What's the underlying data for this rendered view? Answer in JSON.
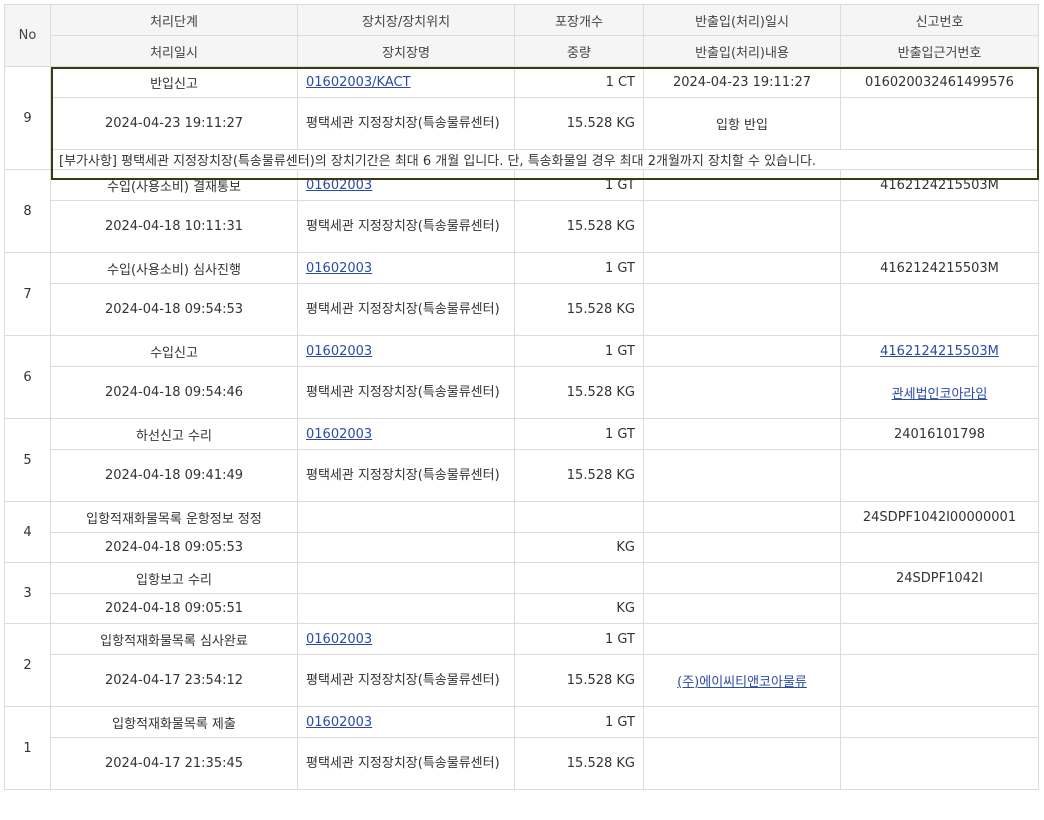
{
  "headers": {
    "no": "No",
    "top": [
      "처리단계",
      "장치장/장치위치",
      "포장개수",
      "반출입(처리)일시",
      "신고번호"
    ],
    "bottom": [
      "처리일시",
      "장치장명",
      "중량",
      "반출입(처리)내용",
      "반출입근거번호"
    ]
  },
  "rows": [
    {
      "no": "9",
      "step": "반입신고",
      "loc_code": "01602003/KACT",
      "loc_link": true,
      "pkg": "1 CT",
      "io_time": "2024-04-23 19:11:27",
      "decl_no": "016020032461499576",
      "decl_link": false,
      "proc_time": "2024-04-23 19:11:27",
      "loc_name": "평택세관 지정장치장(특송물류센터)",
      "weight": "15.528 KG",
      "io_content": "입항 반입",
      "io_link": false,
      "basis_no": "",
      "basis_link": false,
      "note": "[부가사항] 평택세관 지정장치장(특송물류센터)의 장치기간은 최대 6 개월 입니다. 단, 특송화물일 경우 최대 2개월까지 장치할 수 있습니다."
    },
    {
      "no": "8",
      "step": "수입(사용소비) 결재통보",
      "loc_code": "01602003",
      "loc_link": true,
      "pkg": "1 GT",
      "io_time": "",
      "decl_no": "4162124215503M",
      "decl_link": false,
      "proc_time": "2024-04-18 10:11:31",
      "loc_name": "평택세관 지정장치장(특송물류센터)",
      "weight": "15.528 KG",
      "io_content": "",
      "io_link": false,
      "basis_no": "",
      "basis_link": false
    },
    {
      "no": "7",
      "step": "수입(사용소비) 심사진행",
      "loc_code": "01602003",
      "loc_link": true,
      "pkg": "1 GT",
      "io_time": "",
      "decl_no": "4162124215503M",
      "decl_link": false,
      "proc_time": "2024-04-18 09:54:53",
      "loc_name": "평택세관 지정장치장(특송물류센터)",
      "weight": "15.528 KG",
      "io_content": "",
      "io_link": false,
      "basis_no": "",
      "basis_link": false
    },
    {
      "no": "6",
      "step": "수입신고",
      "loc_code": "01602003",
      "loc_link": true,
      "pkg": "1 GT",
      "io_time": "",
      "decl_no": "4162124215503M",
      "decl_link": true,
      "proc_time": "2024-04-18 09:54:46",
      "loc_name": "평택세관 지정장치장(특송물류센터)",
      "weight": "15.528 KG",
      "io_content": "",
      "io_link": false,
      "basis_no": "관세법인코아라임",
      "basis_link": true
    },
    {
      "no": "5",
      "step": "하선신고 수리",
      "loc_code": "01602003",
      "loc_link": true,
      "pkg": "1 GT",
      "io_time": "",
      "decl_no": "24016101798",
      "decl_link": false,
      "proc_time": "2024-04-18 09:41:49",
      "loc_name": "평택세관 지정장치장(특송물류센터)",
      "weight": "15.528 KG",
      "io_content": "",
      "io_link": false,
      "basis_no": "",
      "basis_link": false
    },
    {
      "no": "4",
      "step": "입항적재화물목록 운항정보 정정",
      "loc_code": "",
      "loc_link": false,
      "pkg": "",
      "io_time": "",
      "decl_no": "24SDPF1042I00000001",
      "decl_link": false,
      "proc_time": "2024-04-18 09:05:53",
      "loc_name": "",
      "weight": "KG",
      "io_content": "",
      "io_link": false,
      "basis_no": "",
      "basis_link": false
    },
    {
      "no": "3",
      "step": "입항보고 수리",
      "loc_code": "",
      "loc_link": false,
      "pkg": "",
      "io_time": "",
      "decl_no": "24SDPF1042I",
      "decl_link": false,
      "proc_time": "2024-04-18 09:05:51",
      "loc_name": "",
      "weight": "KG",
      "io_content": "",
      "io_link": false,
      "basis_no": "",
      "basis_link": false
    },
    {
      "no": "2",
      "step": "입항적재화물목록 심사완료",
      "loc_code": "01602003",
      "loc_link": true,
      "pkg": "1 GT",
      "io_time": "",
      "decl_no": "",
      "decl_link": false,
      "proc_time": "2024-04-17 23:54:12",
      "loc_name": "평택세관 지정장치장(특송물류센터)",
      "weight": "15.528 KG",
      "io_content": "(주)에이씨티앤코아물류",
      "io_link": true,
      "basis_no": "",
      "basis_link": false
    },
    {
      "no": "1",
      "step": "입항적재화물목록 제출",
      "loc_code": "01602003",
      "loc_link": true,
      "pkg": "1 GT",
      "io_time": "",
      "decl_no": "",
      "decl_link": false,
      "proc_time": "2024-04-17 21:35:45",
      "loc_name": "평택세관 지정장치장(특송물류센터)",
      "weight": "15.528 KG",
      "io_content": "",
      "io_link": false,
      "basis_no": "",
      "basis_link": false
    }
  ]
}
